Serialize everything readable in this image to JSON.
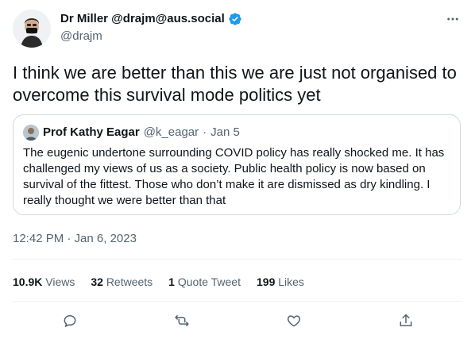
{
  "author": {
    "name": "Dr Miller @drajm@aus.social",
    "handle": "@drajm",
    "verified": true
  },
  "tweet": {
    "text": "I think we are better than this we are just not organised to overcome this survival mode politics yet"
  },
  "quote": {
    "name": "Prof Kathy Eagar",
    "handle": "@k_eagar",
    "dot": "·",
    "date": "Jan 5",
    "text": "The eugenic undertone surrounding COVID policy has really shocked me. It has challenged my views of us as a society. Public health policy is now based on survival of the fittest. Those who don’t make it are dismissed as dry kindling. I really thought we were better than that"
  },
  "meta": {
    "timestamp": "12:42 PM · Jan 6, 2023"
  },
  "stats": {
    "views_count": "10.9K",
    "views_label": "Views",
    "retweets_count": "32",
    "retweets_label": "Retweets",
    "quotes_count": "1",
    "quotes_label": "Quote Tweet",
    "likes_count": "199",
    "likes_label": "Likes"
  },
  "colors": {
    "text": "#0f1419",
    "secondary": "#536471",
    "border": "#cfd9de",
    "verified": "#1d9bf0"
  },
  "icons": {
    "more": "more-icon",
    "reply": "reply-icon",
    "retweet": "retweet-icon",
    "like": "heart-icon",
    "share": "share-icon"
  }
}
